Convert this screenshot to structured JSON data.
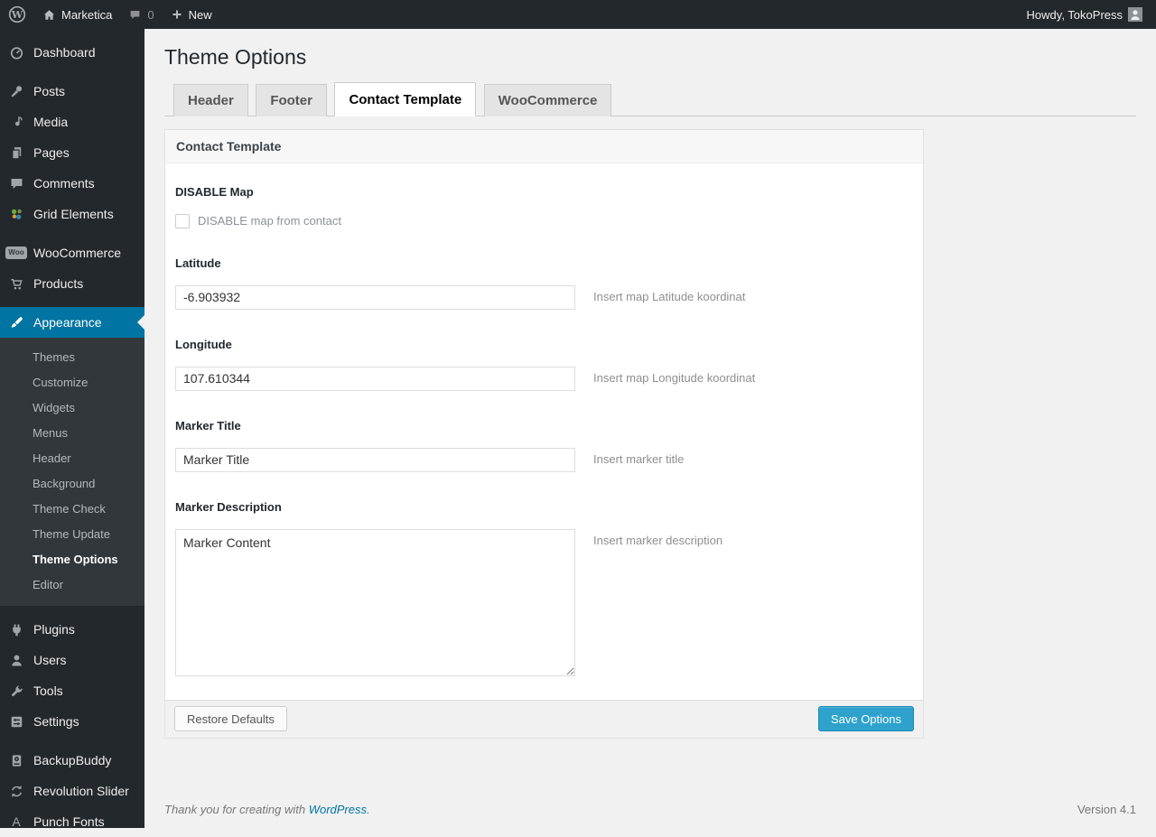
{
  "admin_bar": {
    "site_name": "Marketica",
    "comment_count": "0",
    "new_label": "New",
    "howdy": "Howdy, TokoPress"
  },
  "icons": {
    "wp_logo_glyph": "W",
    "woocommerce_badge": "Woo",
    "punch_fonts_glyph": "A"
  },
  "sidebar": {
    "items": [
      {
        "label": "Dashboard"
      },
      {
        "label": "Posts"
      },
      {
        "label": "Media"
      },
      {
        "label": "Pages"
      },
      {
        "label": "Comments"
      },
      {
        "label": "Grid Elements"
      },
      {
        "label": "WooCommerce"
      },
      {
        "label": "Products"
      },
      {
        "label": "Appearance"
      },
      {
        "label": "Plugins"
      },
      {
        "label": "Users"
      },
      {
        "label": "Tools"
      },
      {
        "label": "Settings"
      },
      {
        "label": "BackupBuddy"
      },
      {
        "label": "Revolution Slider"
      },
      {
        "label": "Punch Fonts"
      }
    ],
    "appearance_submenu": [
      {
        "label": "Themes"
      },
      {
        "label": "Customize"
      },
      {
        "label": "Widgets"
      },
      {
        "label": "Menus"
      },
      {
        "label": "Header"
      },
      {
        "label": "Background"
      },
      {
        "label": "Theme Check"
      },
      {
        "label": "Theme Update"
      },
      {
        "label": "Theme Options"
      },
      {
        "label": "Editor"
      }
    ]
  },
  "page": {
    "title": "Theme Options",
    "tabs": [
      {
        "label": "Header"
      },
      {
        "label": "Footer"
      },
      {
        "label": "Contact Template"
      },
      {
        "label": "WooCommerce"
      }
    ],
    "panel": {
      "title": "Contact Template",
      "fields": [
        {
          "label": "DISABLE Map",
          "type": "checkbox",
          "checkbox_label": "DISABLE map from contact",
          "checked": false
        },
        {
          "label": "Latitude",
          "type": "text",
          "value": "-6.903932",
          "hint": "Insert map Latitude koordinat"
        },
        {
          "label": "Longitude",
          "type": "text",
          "value": "107.610344",
          "hint": "Insert map Longitude koordinat"
        },
        {
          "label": "Marker Title",
          "type": "text",
          "value": "Marker Title",
          "hint": "Insert marker title"
        },
        {
          "label": "Marker Description",
          "type": "textarea",
          "value": "Marker Content",
          "hint": "Insert marker description"
        }
      ],
      "buttons": {
        "restore": "Restore Defaults",
        "save": "Save Options"
      }
    },
    "footer": {
      "thanks_prefix": "Thank you for creating with ",
      "wordpress_link": "WordPress",
      "thanks_suffix": ".",
      "version": "Version 4.1"
    }
  },
  "colors": {
    "accent_blue": "#0074a2",
    "button_primary": "#2ea2cc",
    "admin_dark": "#23282d",
    "submenu_dark": "#32373c",
    "page_bg": "#f1f1f1"
  }
}
